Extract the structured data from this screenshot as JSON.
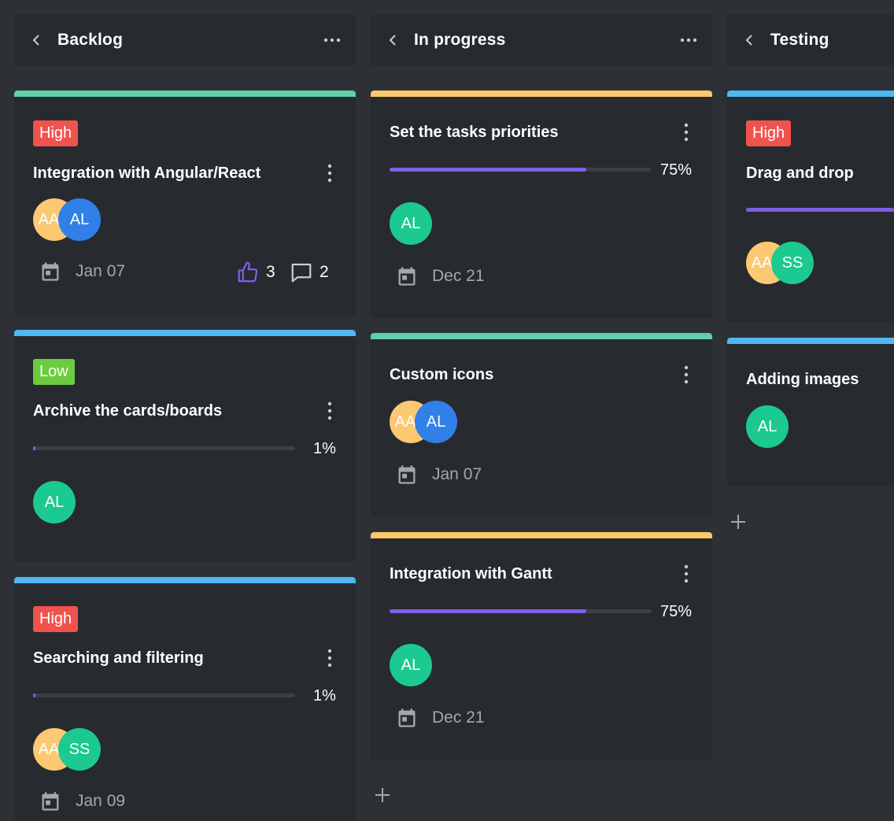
{
  "columns": [
    {
      "title": "Backlog"
    },
    {
      "title": "In progress"
    },
    {
      "title": "Testing"
    }
  ],
  "colors": {
    "background": "#2d3136",
    "card": "#272a2e",
    "green_bar": "#5fd1a8",
    "blue_bar": "#4eb8f0",
    "yellow_bar": "#fbc86a",
    "high": "#f0524e",
    "low": "#6bcc3f",
    "progress": "#7d5fe8",
    "avatar_yellow": "#fcc872",
    "avatar_blue": "#3080e8",
    "avatar_green": "#1cc990"
  },
  "cards": {
    "b1": {
      "priority": "High",
      "title": "Integration with Angular/React",
      "avatars": [
        "AA",
        "AL"
      ],
      "date": "Jan 07",
      "likes": "3",
      "comments": "2"
    },
    "b2": {
      "priority": "Low",
      "title": "Archive the cards/boards",
      "progress": 1,
      "progress_label": "1%",
      "avatars": [
        "AL"
      ]
    },
    "b3": {
      "priority": "High",
      "title": "Searching and filtering",
      "progress": 1,
      "progress_label": "1%",
      "avatars": [
        "AA",
        "SS"
      ],
      "date": "Jan 09"
    },
    "p1": {
      "title": "Set the tasks priorities",
      "progress": 75,
      "progress_label": "75%",
      "avatars": [
        "AL"
      ],
      "date": "Dec 21"
    },
    "p2": {
      "title": "Custom icons",
      "avatars": [
        "AA",
        "AL"
      ],
      "date": "Jan 07"
    },
    "p3": {
      "title": "Integration with Gantt",
      "progress": 75,
      "progress_label": "75%",
      "avatars": [
        "AL"
      ],
      "date": "Dec 21"
    },
    "t1": {
      "priority": "High",
      "title": "Drag and drop",
      "avatars": [
        "AA",
        "SS"
      ]
    },
    "t2": {
      "title": "Adding images",
      "avatars": [
        "AL"
      ]
    }
  },
  "icons": {
    "collapse": "chevron-left-icon",
    "menu": "more-horizontal-icon",
    "card_menu": "more-vertical-icon",
    "date": "calendar-icon",
    "like": "thumbs-up-icon",
    "comment": "comment-icon",
    "add": "plus-icon"
  }
}
